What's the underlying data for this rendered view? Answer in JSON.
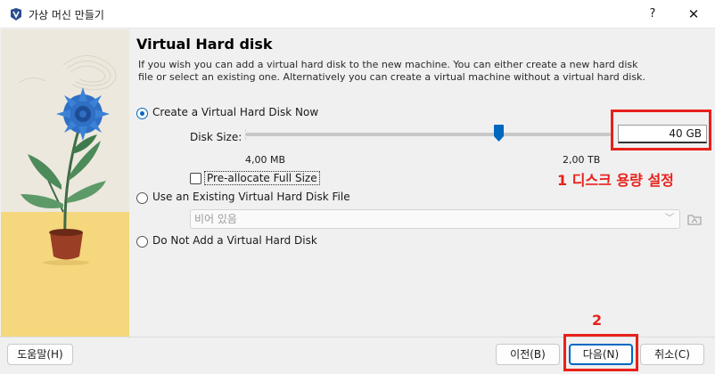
{
  "window": {
    "title": "가상 머신 만들기",
    "help_label": "?",
    "close_label": "✕",
    "app_icon": "virtualbox-icon"
  },
  "page": {
    "heading": "Virtual Hard disk",
    "description": "If you wish you can add a virtual hard disk to the new machine. You can either create a new hard disk file or select an existing one. Alternatively you can create a virtual machine without a virtual hard disk."
  },
  "options": {
    "create_new": {
      "label": "Create a Virtual Hard Disk Now",
      "checked": true
    },
    "use_existing": {
      "label": "Use an Existing Virtual Hard Disk File",
      "checked": false
    },
    "do_not_add": {
      "label": "Do Not Add a Virtual Hard Disk",
      "checked": false
    }
  },
  "disk_size": {
    "label": "Disk Size:",
    "value": "40 GB",
    "min_label": "4,00 MB",
    "max_label": "2,00 TB"
  },
  "preallocate": {
    "label": "Pre-allocate Full Size",
    "checked": false
  },
  "existing_file": {
    "value": "비어 있음",
    "folder_icon": "folder-icon"
  },
  "annotations": {
    "step1": "1 디스크 용량 설정",
    "step2": "2",
    "color": "#e8201a"
  },
  "buttons": {
    "help": "도움말(H)",
    "back": "이전(B)",
    "next": "다음(N)",
    "cancel": "취소(C)"
  },
  "colors": {
    "accent": "#0067c0",
    "annotation": "#e8201a"
  }
}
